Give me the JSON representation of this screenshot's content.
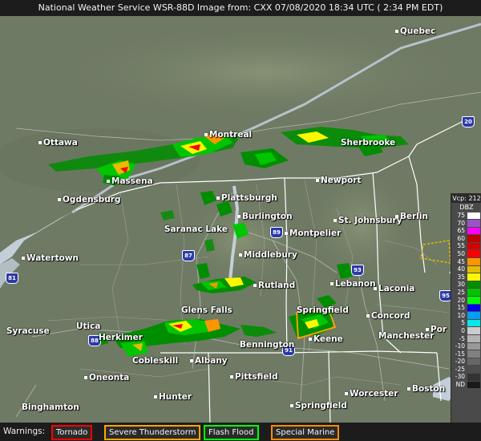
{
  "header": {
    "title": "National Weather Service WSR-88D Image from: CXX 07/08/2020 18:34 UTC ( 2:34 PM EDT)"
  },
  "cities": [
    {
      "id": "quebec",
      "name": "Quebec"
    },
    {
      "id": "ottawa",
      "name": "Ottawa"
    },
    {
      "id": "montreal",
      "name": "Montreal"
    },
    {
      "id": "sherbrooke",
      "name": "Sherbrooke"
    },
    {
      "id": "massena",
      "name": "Massena"
    },
    {
      "id": "newport",
      "name": "Newport"
    },
    {
      "id": "ogdensburg",
      "name": "Ogdensburg"
    },
    {
      "id": "plattsburgh",
      "name": "Plattsburgh"
    },
    {
      "id": "burlington",
      "name": "Burlington"
    },
    {
      "id": "st-johnsbury",
      "name": "St. Johnsbury"
    },
    {
      "id": "berlin",
      "name": "Berlin"
    },
    {
      "id": "saranac-lake",
      "name": "Saranac Lake"
    },
    {
      "id": "montpelier",
      "name": "Montpelier"
    },
    {
      "id": "watertown",
      "name": "Watertown"
    },
    {
      "id": "middlebury",
      "name": "Middlebury"
    },
    {
      "id": "lebanon",
      "name": "Lebanon"
    },
    {
      "id": "laconia",
      "name": "Laconia"
    },
    {
      "id": "rutland",
      "name": "Rutland"
    },
    {
      "id": "glens-falls",
      "name": "Glens Falls"
    },
    {
      "id": "springfield-vt",
      "name": "Springfield"
    },
    {
      "id": "concord",
      "name": "Concord"
    },
    {
      "id": "syracuse",
      "name": "Syracuse"
    },
    {
      "id": "utica",
      "name": "Utica"
    },
    {
      "id": "herkimer",
      "name": "Herkimer"
    },
    {
      "id": "keene",
      "name": "Keene"
    },
    {
      "id": "manchester",
      "name": "Manchester"
    },
    {
      "id": "portsmouth",
      "name": "Por"
    },
    {
      "id": "bennington",
      "name": "Bennington"
    },
    {
      "id": "cobleskill",
      "name": "Cobleskill"
    },
    {
      "id": "albany",
      "name": "Albany"
    },
    {
      "id": "oneonta",
      "name": "Oneonta"
    },
    {
      "id": "pittsfield",
      "name": "Pittsfield"
    },
    {
      "id": "hunter",
      "name": "Hunter"
    },
    {
      "id": "worcester",
      "name": "Worcester"
    },
    {
      "id": "boston",
      "name": "Boston"
    },
    {
      "id": "springfield-ma",
      "name": "Springfield"
    },
    {
      "id": "binghamton",
      "name": "Binghamton"
    }
  ],
  "highways": [
    "20",
    "81",
    "87",
    "89",
    "93",
    "95",
    "91",
    "88"
  ],
  "legend": {
    "title": "Vcp: 212",
    "unit": "DBZ",
    "rows": [
      {
        "value": "75",
        "color": "#fdfdfd"
      },
      {
        "value": "70",
        "color": "#9854c6"
      },
      {
        "value": "65",
        "color": "#f800fd"
      },
      {
        "value": "60",
        "color": "#bc0000"
      },
      {
        "value": "55",
        "color": "#d40000"
      },
      {
        "value": "50",
        "color": "#fd0000"
      },
      {
        "value": "45",
        "color": "#fd9500"
      },
      {
        "value": "40",
        "color": "#e5bc00"
      },
      {
        "value": "35",
        "color": "#fdf802"
      },
      {
        "value": "30",
        "color": "#008e00"
      },
      {
        "value": "25",
        "color": "#01c501"
      },
      {
        "value": "20",
        "color": "#02fd02"
      },
      {
        "value": "15",
        "color": "#0300f4"
      },
      {
        "value": "10",
        "color": "#019ff4"
      },
      {
        "value": "5",
        "color": "#04e9e7"
      },
      {
        "value": "0",
        "color": "#cccccc"
      },
      {
        "value": "-5",
        "color": "#b3b3b3"
      },
      {
        "value": "-10",
        "color": "#999999"
      },
      {
        "value": "-15",
        "color": "#808080"
      },
      {
        "value": "-20",
        "color": "#666666"
      },
      {
        "value": "-25",
        "color": "#4d4d4d"
      },
      {
        "value": "-30",
        "color": "#333333"
      },
      {
        "value": "ND",
        "color": "#1a1a1a"
      }
    ]
  },
  "warnings": {
    "label": "Warnings:",
    "items": [
      {
        "label": "Tornado",
        "color": "#ff0000"
      },
      {
        "label": "Severe Thunderstorm",
        "color": "#ffa500"
      },
      {
        "label": "Flash Flood",
        "color": "#00ff00"
      },
      {
        "label": "Special Marine",
        "color": "#ff8c00"
      }
    ]
  },
  "colors": {
    "terrain": "#6f7a64",
    "highland": "#7f8a6e",
    "water": "#c3cfd8",
    "border": "#ffffff",
    "county": "#a9a9a9"
  }
}
